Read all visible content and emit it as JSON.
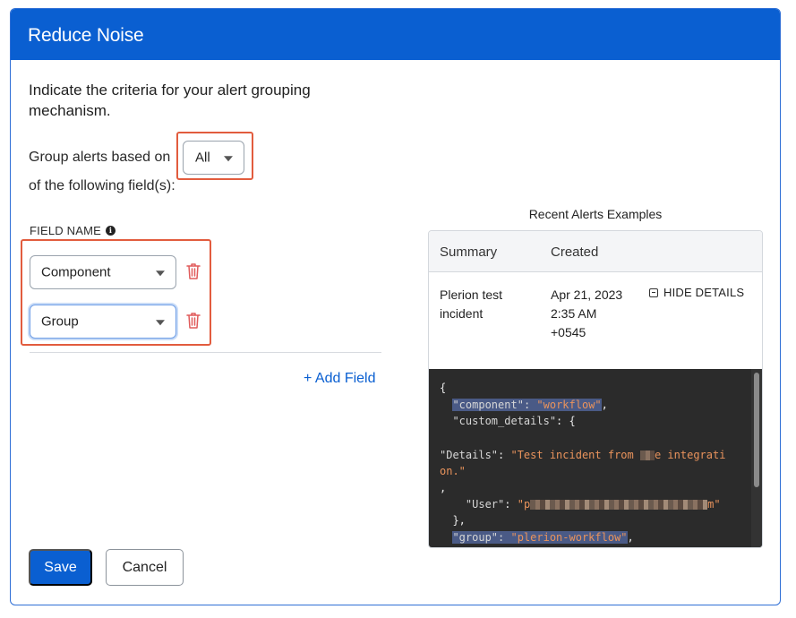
{
  "modal": {
    "title": "Reduce Noise"
  },
  "intro": {
    "text": "Indicate the criteria for your alert grouping mechanism."
  },
  "grouping": {
    "label_before": "Group alerts based on",
    "selected": "All",
    "label_after": "of the following field(s):"
  },
  "fields": {
    "header": "FIELD NAME",
    "items": [
      {
        "value": "Component"
      },
      {
        "value": "Group"
      }
    ],
    "add_label": "+ Add Field"
  },
  "actions": {
    "save_label": "Save",
    "cancel_label": "Cancel"
  },
  "recent": {
    "title": "Recent Alerts Examples",
    "columns": {
      "summary": "Summary",
      "created": "Created"
    },
    "row": {
      "summary": "Plerion test incident",
      "created": "Apr 21, 2023 2:35 AM +0545",
      "hide_label": "HIDE DETAILS"
    },
    "code": {
      "open_brace": "{",
      "component_key": "\"component\"",
      "component_val": "\"workflow\"",
      "custom_details_key": "\"custom_details\"",
      "details_key": "\"Details\"",
      "details_val_a": "\"Test incident from ",
      "details_val_b": "e integrati",
      "details_val_c": "on.\"",
      "comma": ",",
      "user_key": "\"User\"",
      "user_val_start": "\"p",
      "user_val_end": "m\"",
      "close_inner": "},",
      "group_key": "\"group\"",
      "group_val": "\"plerion-workflow\""
    }
  },
  "colors": {
    "primary": "#0a5fd1",
    "highlight": "#e25c3e",
    "trash": "#e05a5a",
    "code_bg": "#2b2b2b",
    "code_string": "#e9935c"
  }
}
